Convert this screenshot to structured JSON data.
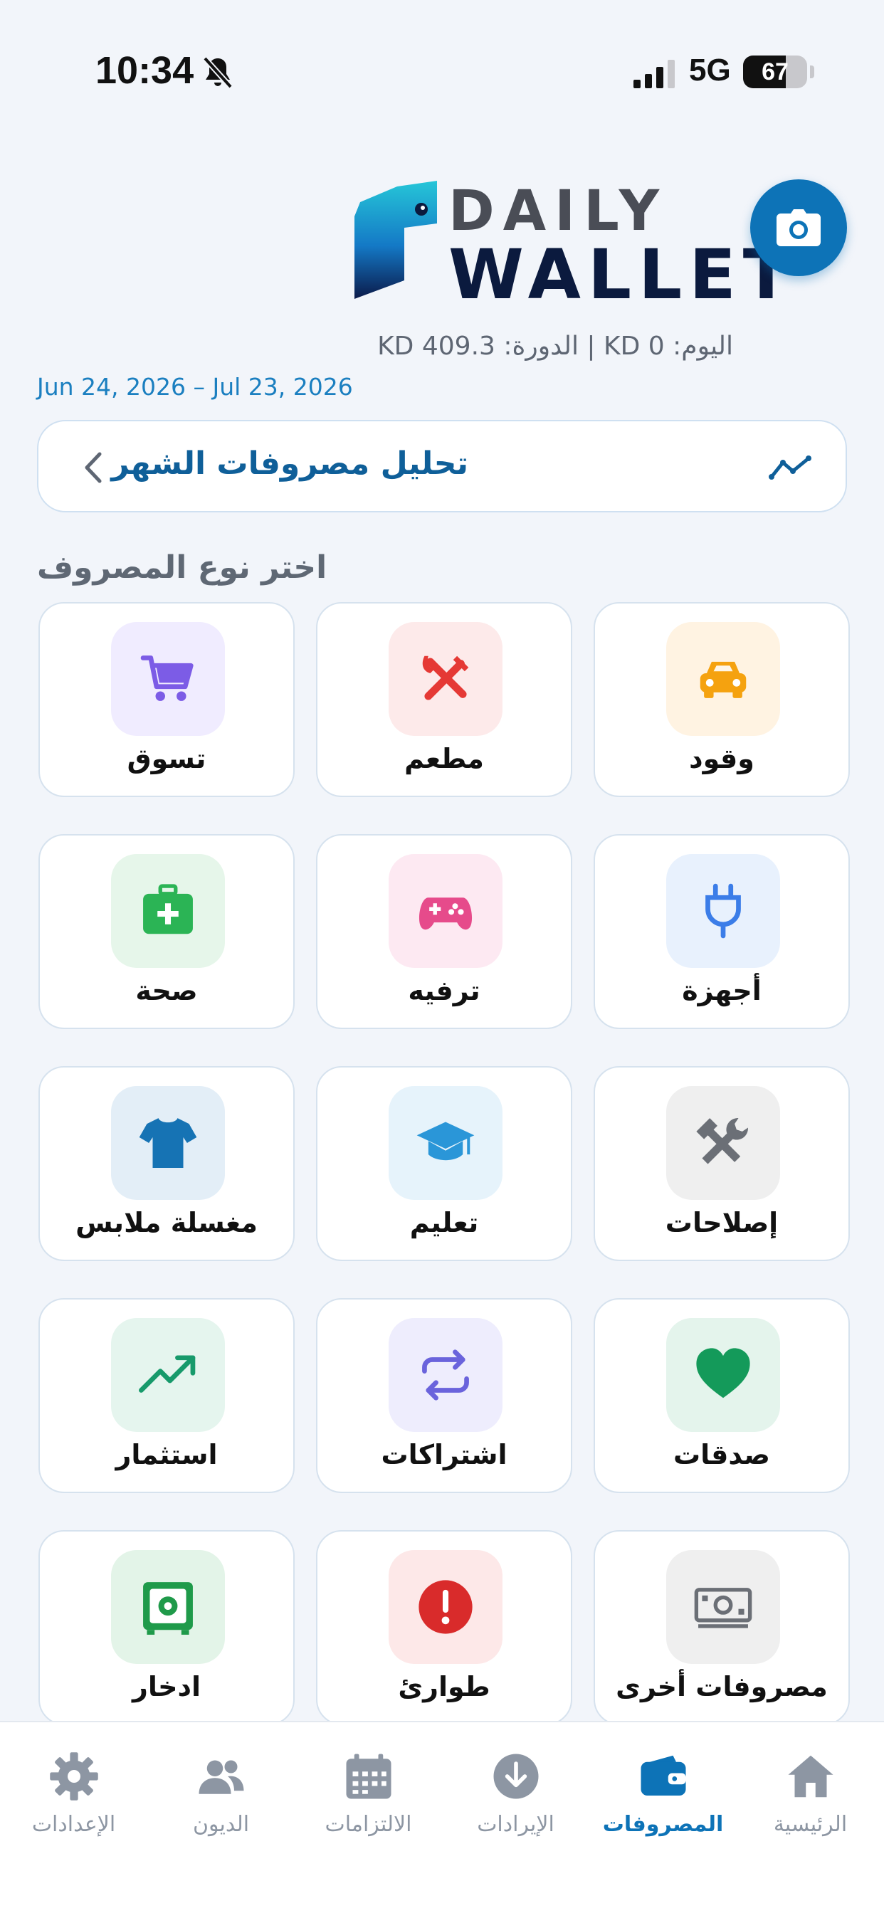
{
  "status_bar": {
    "time": "10:34",
    "network": "5G",
    "battery": "67",
    "battery_level": 0.67
  },
  "header": {
    "logo_line1": "DAILY",
    "logo_line2": "WALLET",
    "summary": "اليوم: 0 KD | الدورة: 409.3 KD",
    "date_range": "Jun 24, 2026 – Jul 23, 2026"
  },
  "analysis": {
    "label": "تحليل مصروفات الشهر"
  },
  "section_title": "اختر نوع المصروف",
  "categories": [
    {
      "label": "وقود",
      "icon": "car-icon",
      "color": "#f5a20f",
      "bg": "#fff3e2"
    },
    {
      "label": "مطعم",
      "icon": "fork-knife-icon",
      "color": "#e53935",
      "bg": "#fdeaea"
    },
    {
      "label": "تسوق",
      "icon": "cart-icon",
      "color": "#7c5ce6",
      "bg": "#f0ecff"
    },
    {
      "label": "أجهزة",
      "icon": "plug-icon",
      "color": "#3b7de8",
      "bg": "#e8f1fd"
    },
    {
      "label": "ترفيه",
      "icon": "gamepad-icon",
      "color": "#e64b8b",
      "bg": "#fde9f2"
    },
    {
      "label": "صحة",
      "icon": "medkit-icon",
      "color": "#2bb455",
      "bg": "#e6f6ea"
    },
    {
      "label": "إصلاحات",
      "icon": "tools-icon",
      "color": "#6b6f76",
      "bg": "#efefef"
    },
    {
      "label": "تعليم",
      "icon": "graduation-cap-icon",
      "color": "#2a96d8",
      "bg": "#e6f3fb"
    },
    {
      "label": "مغسلة ملابس",
      "icon": "tshirt-icon",
      "color": "#1673b4",
      "bg": "#e3eef7"
    },
    {
      "label": "صدقات",
      "icon": "heart-icon",
      "color": "#149a5a",
      "bg": "#e4f4ec"
    },
    {
      "label": "اشتراكات",
      "icon": "repeat-icon",
      "color": "#6a63dc",
      "bg": "#eeedfd"
    },
    {
      "label": "استثمار",
      "icon": "trend-up-icon",
      "color": "#179a6b",
      "bg": "#e5f5ee"
    },
    {
      "label": "مصروفات أخرى",
      "icon": "money-icon",
      "color": "#6b6f76",
      "bg": "#efefef"
    },
    {
      "label": "طوارئ",
      "icon": "alert-icon",
      "color": "#d92b2b",
      "bg": "#fde8e8"
    },
    {
      "label": "ادخار",
      "icon": "safe-icon",
      "color": "#1f9a4a",
      "bg": "#e3f4e8"
    }
  ],
  "nav": [
    {
      "label": "الرئيسية",
      "icon": "home-icon",
      "active": false
    },
    {
      "label": "المصروفات",
      "icon": "wallet-icon",
      "active": true
    },
    {
      "label": "الإيرادات",
      "icon": "download-icon",
      "active": false
    },
    {
      "label": "الالتزامات",
      "icon": "calendar-icon",
      "active": false
    },
    {
      "label": "الديون",
      "icon": "users-icon",
      "active": false
    },
    {
      "label": "الإعدادات",
      "icon": "gear-icon",
      "active": false
    }
  ],
  "colors": {
    "accent": "#0d73b7",
    "nav_inactive": "#8d96a3",
    "background": "#f2f5fa"
  }
}
